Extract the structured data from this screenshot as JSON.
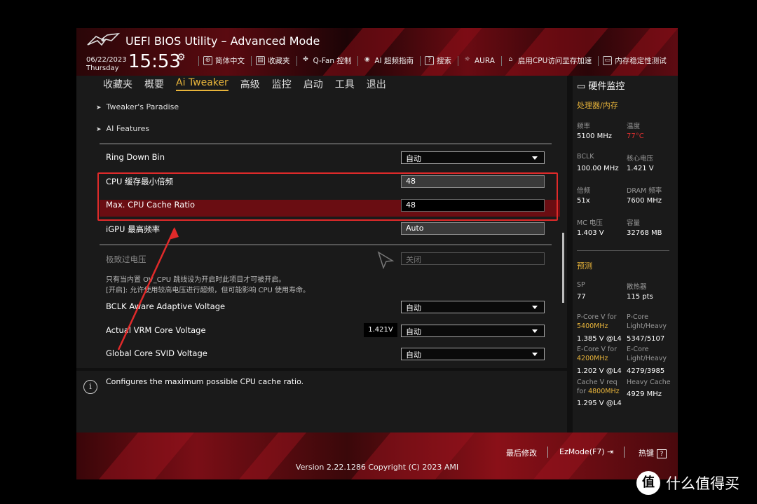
{
  "header": {
    "title": "UEFI BIOS Utility – Advanced Mode",
    "date": "06/22/2023",
    "weekday": "Thursday",
    "time": "15:53",
    "toolbar": [
      {
        "icon": "globe-icon",
        "label": "简体中文"
      },
      {
        "icon": "favorites-icon",
        "label": "收藏夹"
      },
      {
        "icon": "fan-icon",
        "label": "Q-Fan 控制"
      },
      {
        "icon": "ai-icon",
        "label": "AI 超频指南"
      },
      {
        "icon": "help-icon",
        "label": "搜索"
      },
      {
        "icon": "aura-icon",
        "label": "AURA"
      },
      {
        "icon": "memory-icon",
        "label": "启用CPU访问显存加速"
      },
      {
        "icon": "memtest-icon",
        "label": "内存稳定性测试"
      }
    ]
  },
  "nav": {
    "tabs": [
      "收藏夹",
      "概要",
      "Ai Tweaker",
      "高级",
      "监控",
      "启动",
      "工具",
      "退出"
    ],
    "active": "Ai Tweaker"
  },
  "main": {
    "sub1": "Tweaker's Paradise",
    "sub2": "AI Features",
    "ring_down_bin": {
      "label": "Ring Down Bin",
      "value": "自动"
    },
    "cpu_cache_min": {
      "label": "CPU 缓存最小倍频",
      "value": "48"
    },
    "cpu_cache_max": {
      "label": "Max. CPU Cache Ratio",
      "value": "48"
    },
    "igpu_max": {
      "label": "iGPU 最高频率",
      "value": "Auto"
    },
    "extreme_ov": {
      "label": "极致过电压",
      "value": "关闭"
    },
    "note1": "只有当内置 OV_CPU 跳线设为开启时此项目才可被开启。",
    "note2": "[开启]: 允许使用较高电压进行超频，但可能影响 CPU 使用寿命。",
    "bclk_aware": {
      "label": "BCLK Aware Adaptive Voltage",
      "value": "自动"
    },
    "actual_vrm": {
      "label": "Actual VRM Core Voltage",
      "value": "自动",
      "badge": "1.421V"
    },
    "global_svid": {
      "label": "Global Core SVID Voltage",
      "value": "自动"
    }
  },
  "info": {
    "text": "Configures the maximum possible CPU cache ratio."
  },
  "hw": {
    "title": "硬件监控",
    "cpu_section": "处理器/内存",
    "freq_label": "频率",
    "freq_value": "5100 MHz",
    "temp_label": "温度",
    "temp_value": "77°C",
    "bclk_label": "BCLK",
    "bclk_value": "100.00 MHz",
    "vcore_label": "核心电压",
    "vcore_value": "1.421 V",
    "ratio_label": "倍频",
    "ratio_value": "51x",
    "dram_label": "DRAM 频率",
    "dram_value": "7600 MHz",
    "mc_label": "MC 电压",
    "mc_value": "1.403 V",
    "cap_label": "容量",
    "cap_value": "32768 MB",
    "pred_section": "预测",
    "sp_label": "SP",
    "sp_value": "77",
    "cooler_label": "散热器",
    "cooler_value": "115 pts",
    "pcore_v_label1": "P-Core V for",
    "pcore_v_freq": "5400MHz",
    "pcore_v_value": "1.385 V @L4",
    "pcore_lh_label1": "P-Core",
    "pcore_lh_label2": "Light/Heavy",
    "pcore_lh_value": "5347/5107",
    "ecore_v_label1": "E-Core V for",
    "ecore_v_freq": "4200MHz",
    "ecore_v_value": "1.202 V @L4",
    "ecore_lh_label1": "E-Core",
    "ecore_lh_label2": "Light/Heavy",
    "ecore_lh_value": "4279/3985",
    "cache_v_label1": "Cache V req",
    "cache_v_label2": "for",
    "cache_v_freq": "4800MHz",
    "cache_v_value": "1.295 V @L4",
    "heavy_cache_label": "Heavy Cache",
    "heavy_cache_value": "4929 MHz"
  },
  "footer": {
    "last_modified": "最后修改",
    "ezmode": "EzMode(F7)",
    "hotkeys": "热键",
    "version": "Version 2.22.1286 Copyright (C) 2023 AMI"
  },
  "watermark": {
    "badge": "值",
    "text": "什么值得买"
  },
  "colors": {
    "accent": "#e8b43a",
    "highlight": "#6a0d12",
    "annotation_red": "#e02a2a"
  }
}
